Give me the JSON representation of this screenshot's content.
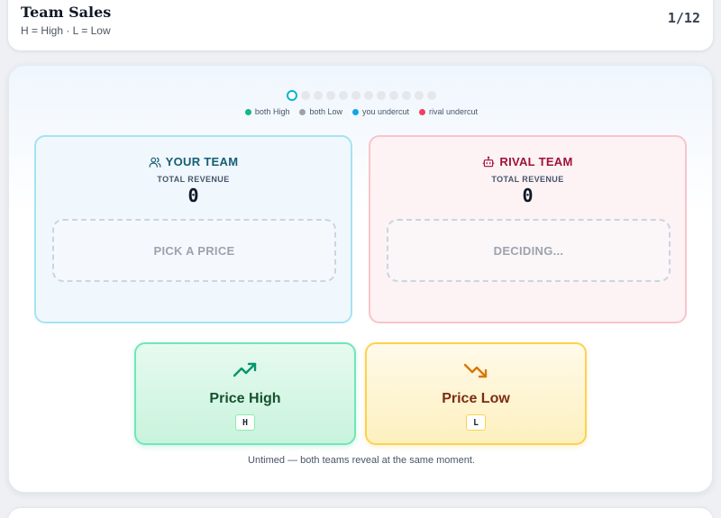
{
  "header": {
    "title": "Team Sales",
    "subtitle": "H = High · L = Low",
    "round_counter": "1/12"
  },
  "progress": {
    "total_rounds": 12,
    "current_round": 1
  },
  "legend": [
    {
      "label": "both High",
      "color": "#10b981"
    },
    {
      "label": "both Low",
      "color": "#9ca3af"
    },
    {
      "label": "you undercut",
      "color": "#0ea5e9"
    },
    {
      "label": "rival undercut",
      "color": "#f43f5e"
    }
  ],
  "your_team": {
    "title": "YOUR TEAM",
    "icon": "users-icon",
    "revenue_label": "TOTAL REVENUE",
    "revenue_value": "0",
    "slot_text": "PICK A PRICE"
  },
  "rival_team": {
    "title": "RIVAL TEAM",
    "icon": "robot-icon",
    "revenue_label": "TOTAL REVENUE",
    "revenue_value": "0",
    "slot_text": "DECIDING..."
  },
  "choices": {
    "high": {
      "label": "Price High",
      "key": "H",
      "icon": "trending-up-icon",
      "color": "#059669"
    },
    "low": {
      "label": "Price Low",
      "key": "L",
      "icon": "trending-down-icon",
      "color": "#d97706"
    }
  },
  "footnote": "Untimed — both teams reveal at the same moment."
}
